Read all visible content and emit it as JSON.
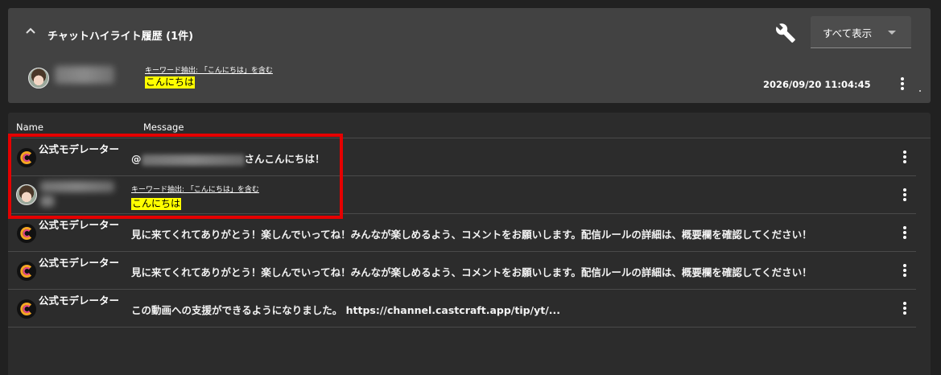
{
  "highlight": {
    "title": "チャットハイライト履歴 (1件)",
    "show_all_label": "すべて表示",
    "entry": {
      "keyword_label": "キーワード抽出: 「こんにちは」を含む",
      "keyword_text": "こんにちは",
      "timestamp": "2026/09/20 11:04:45"
    }
  },
  "columns": {
    "name": "Name",
    "message": "Message"
  },
  "rows": [
    {
      "name": "公式モデレーター",
      "message_suffix": "さんこんにちは！",
      "mention_prefix": "@"
    },
    {
      "keyword_label": "キーワード抽出: 「こんにちは」を含む",
      "keyword_text": "こんにちは"
    },
    {
      "name": "公式モデレーター",
      "message": "見に来てくれてありがとう！楽しんでいってね！みんなが楽しめるよう、コメントをお願いします。配信ルールの詳細は、概要欄を確認してください！"
    },
    {
      "name": "公式モデレーター",
      "message": "見に来てくれてありがとう！楽しんでいってね！みんなが楽しめるよう、コメントをお願いします。配信ルールの詳細は、概要欄を確認してください！"
    },
    {
      "name": "公式モデレーター",
      "message": "この動画への支援ができるようになりました。 https://channel.castcraft.app/tip/yt/..."
    }
  ],
  "icons": {
    "collapse": "chevron-up-icon",
    "settings": "wrench-icon",
    "more": "more-vert-icon"
  },
  "colors": {
    "highlight": "#ffff00",
    "annotation": "#e50000",
    "panel": "#424242",
    "background": "#212121"
  }
}
